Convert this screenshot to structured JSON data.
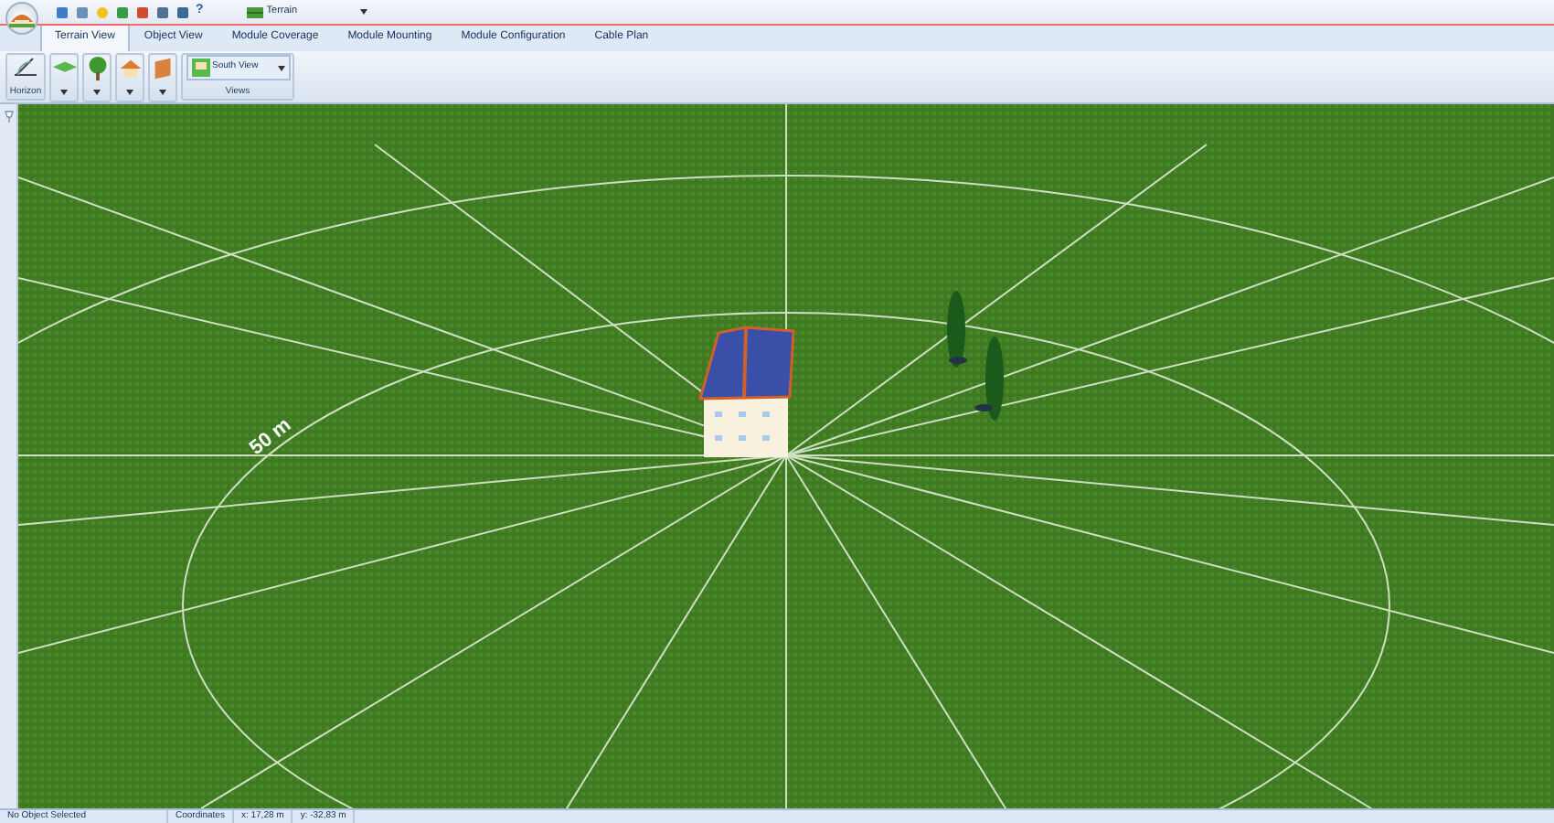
{
  "quick_access": {
    "help": "?",
    "dropdown_value": "Terrain"
  },
  "tabs": [
    {
      "label": "Terrain View",
      "selected": true
    },
    {
      "label": "Object View",
      "selected": false
    },
    {
      "label": "Module Coverage",
      "selected": false
    },
    {
      "label": "Module Mounting",
      "selected": false
    },
    {
      "label": "Module Configuration",
      "selected": false
    },
    {
      "label": "Cable Plan",
      "selected": false
    }
  ],
  "ribbon": {
    "horizon_group": "Horizon",
    "views_dropdown": "South View",
    "views_group": "Views"
  },
  "viewport": {
    "distance_label": "50 m"
  },
  "status_bar": {
    "selection": "No Object Selected",
    "coordinates_label": "Coordinates",
    "x": "x: 17,28 m",
    "y": "y: -32,83 m"
  }
}
